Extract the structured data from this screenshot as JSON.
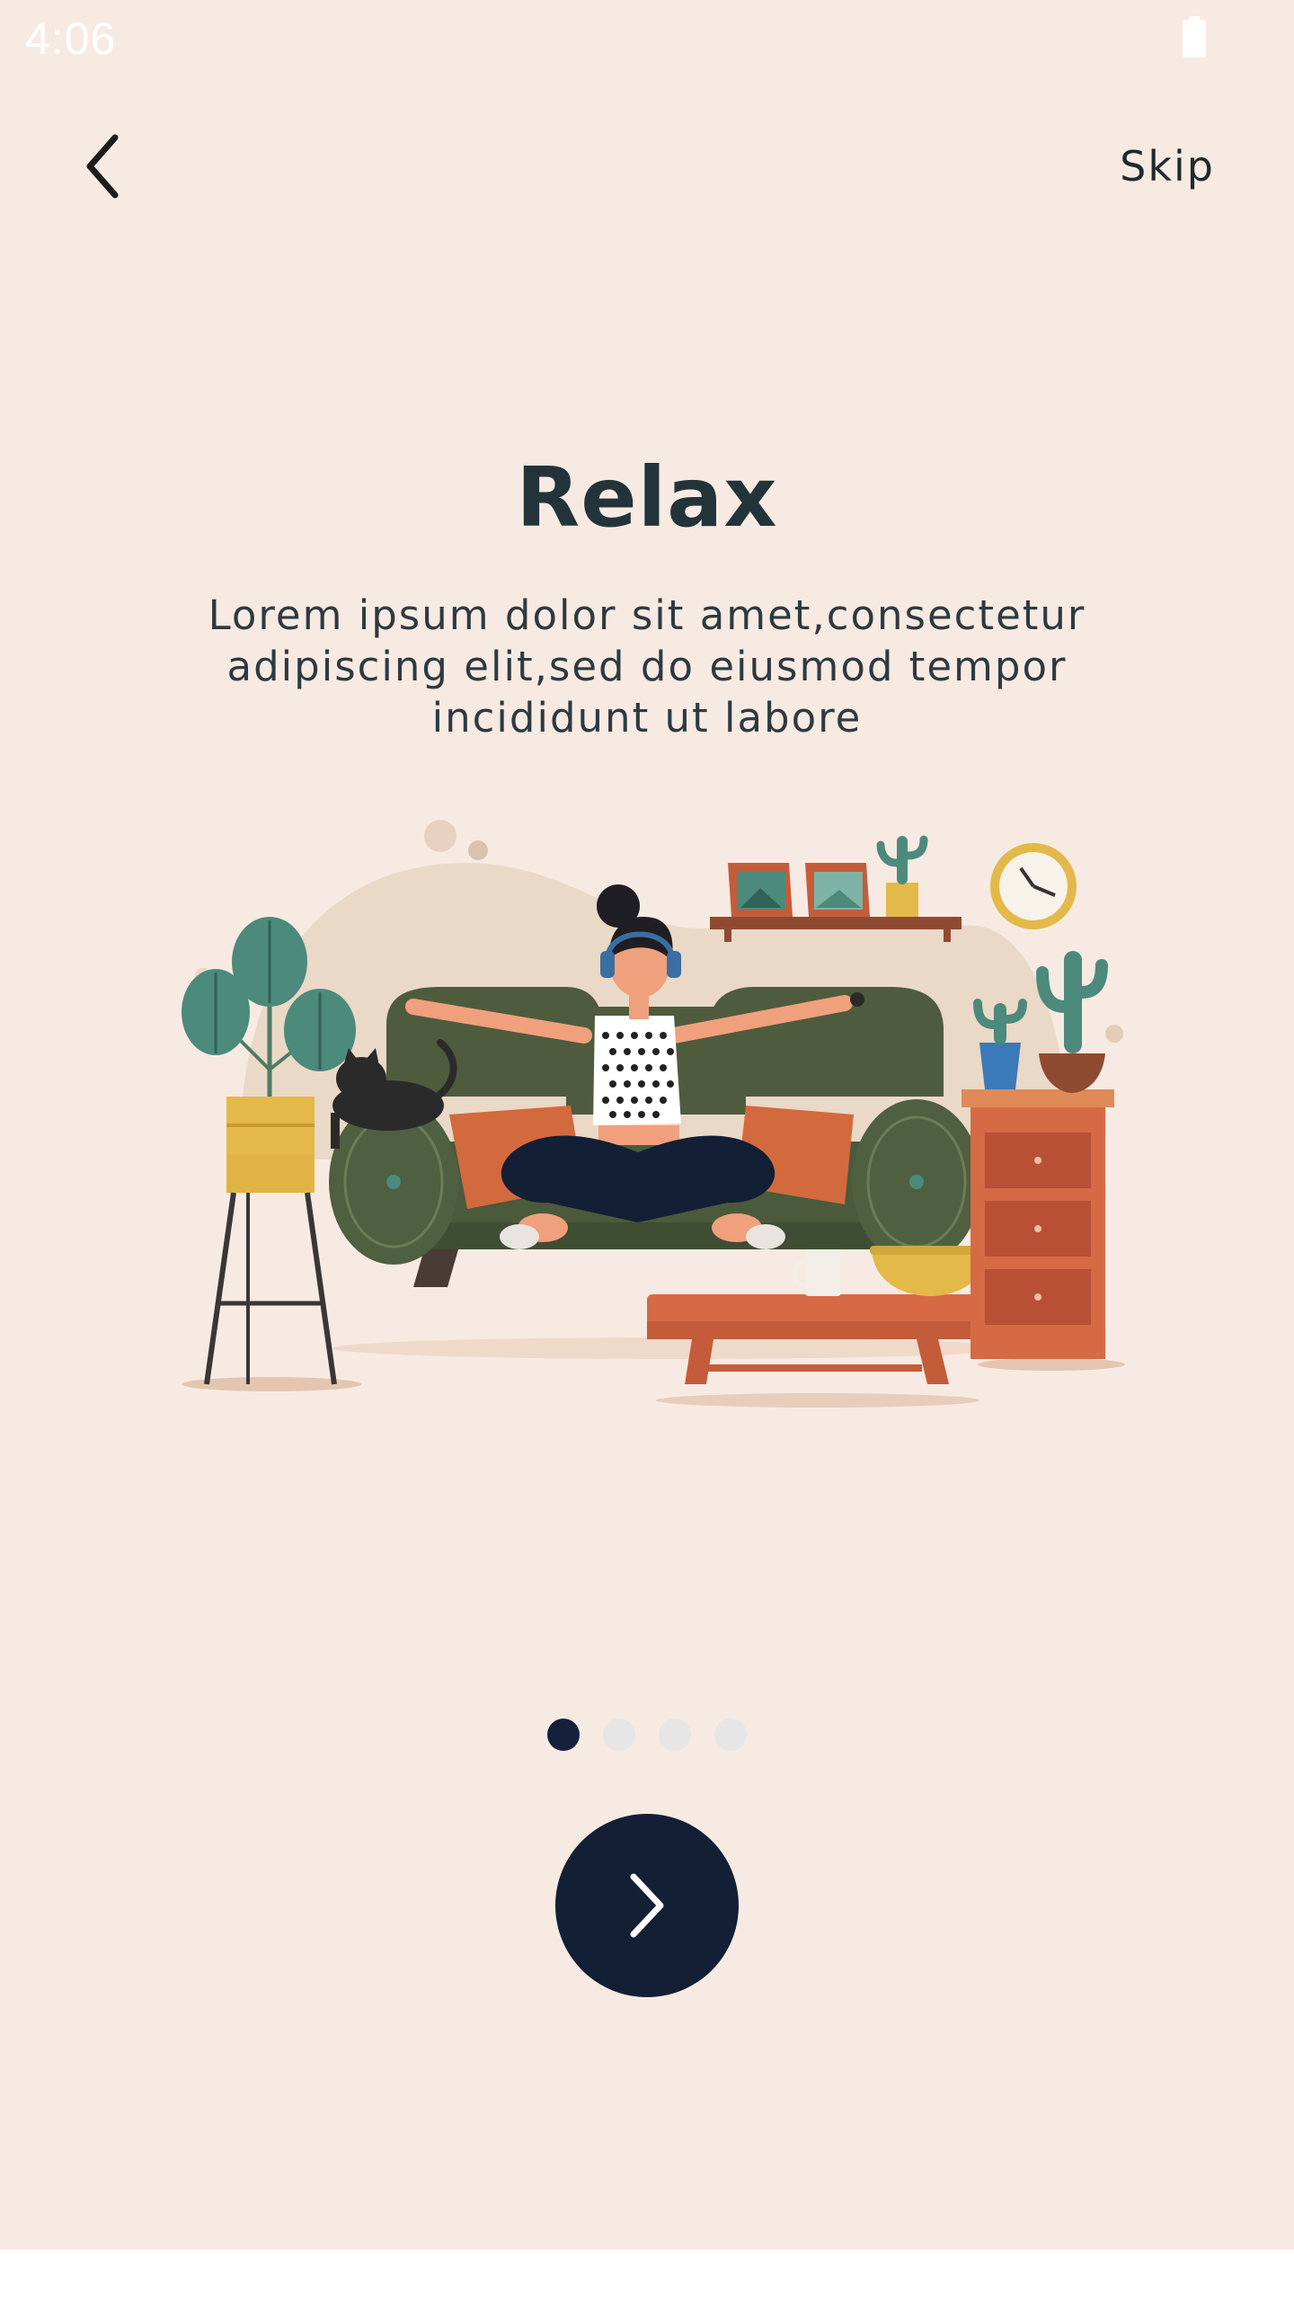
{
  "status_bar": {
    "time": "4:06",
    "battery_icon": "battery-icon"
  },
  "nav": {
    "back_icon": "chevron-left-icon",
    "skip_label": "Skip"
  },
  "onboarding": {
    "title": "Relax",
    "description": "Lorem ipsum dolor sit amet,consectetur adipiscing elit,sed do eiusmod tempor incididunt ut labore",
    "illustration": "woman-relaxing-on-sofa-illustration"
  },
  "pagination": {
    "total": 4,
    "active_index": 0
  },
  "next_button": {
    "icon": "chevron-right-icon"
  },
  "colors": {
    "background": "#f7eae2",
    "primary": "#131f35",
    "title": "#22343a",
    "dot_inactive": "#e6e6e6"
  }
}
